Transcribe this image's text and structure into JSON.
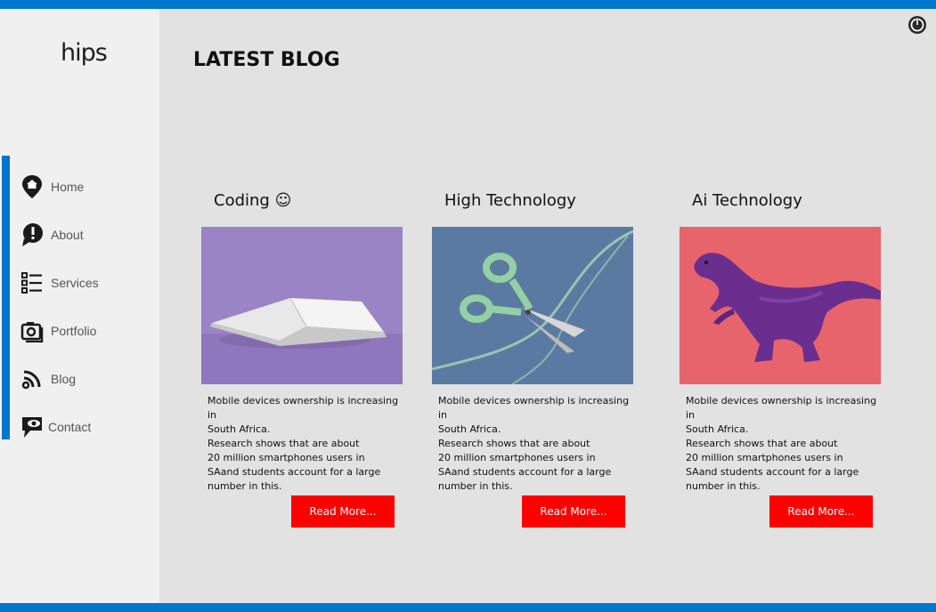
{
  "brand": {
    "logo_text": "hips",
    "accent": "#0077cc"
  },
  "sidebar": {
    "items": [
      {
        "label": "Home",
        "icon": "home-pin-icon"
      },
      {
        "label": "About",
        "icon": "info-bubble-icon"
      },
      {
        "label": "Services",
        "icon": "list-icon"
      },
      {
        "label": "Portfolio",
        "icon": "camera-icon"
      },
      {
        "label": "Blog",
        "icon": "rss-icon"
      },
      {
        "label": "Contact",
        "icon": "chat-eye-icon"
      }
    ]
  },
  "header": {
    "power_icon": "power-icon"
  },
  "main": {
    "heading": "LATEST BLOG",
    "cards": [
      {
        "title": "Coding ☺",
        "image": "open-book-on-purple",
        "text": "Mobile devices ownership is increasing in\nSouth Africa.\nResearch shows that are about\n 20 million smartphones users in\nSAand students account for a large\n number in this.",
        "button": "Read More..."
      },
      {
        "title": "High Technology",
        "image": "green-scissors-on-blue",
        "text": "Mobile devices ownership is increasing in\nSouth Africa.\nResearch shows that are about\n 20 million smartphones users in\nSAand students account for a large\n number in this.",
        "button": "Read More..."
      },
      {
        "title": "Ai Technology",
        "image": "purple-dinosaur-on-pink",
        "text": "Mobile devices ownership is increasing in\nSouth Africa.\nResearch shows that are about\n 20 million smartphones users in\nSAand students account for a large\n number in this.",
        "button": "Read More..."
      }
    ]
  },
  "colors": {
    "button_bg": "#ff0000",
    "sidebar_bg": "#f0f0f0",
    "content_bg": "#e2e2e2"
  }
}
